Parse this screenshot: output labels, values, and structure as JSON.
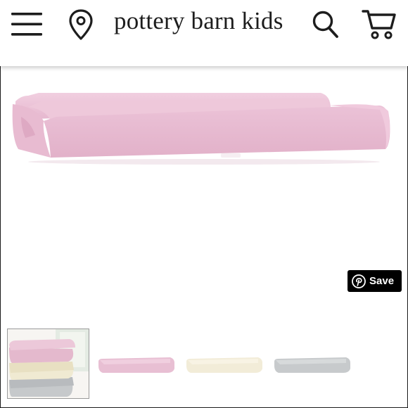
{
  "header": {
    "brand": "pottery barn kids",
    "menu_icon": "hamburger-menu-icon",
    "location_icon": "map-pin-icon",
    "search_icon": "search-icon",
    "cart_icon": "shopping-cart-icon"
  },
  "product": {
    "image": "pink changing pad cover",
    "colors": [
      "#e9bfd4",
      "#f4eedb",
      "#c8cbcd"
    ]
  },
  "save_button": {
    "label": "Save",
    "icon": "pinterest-icon"
  },
  "thumbnails": [
    {
      "name": "stacked-set",
      "selected": true
    },
    {
      "name": "pink",
      "color": "#e7bcd2"
    },
    {
      "name": "ivory",
      "color": "#f3edda"
    },
    {
      "name": "gray",
      "color": "#c7cacc"
    }
  ]
}
